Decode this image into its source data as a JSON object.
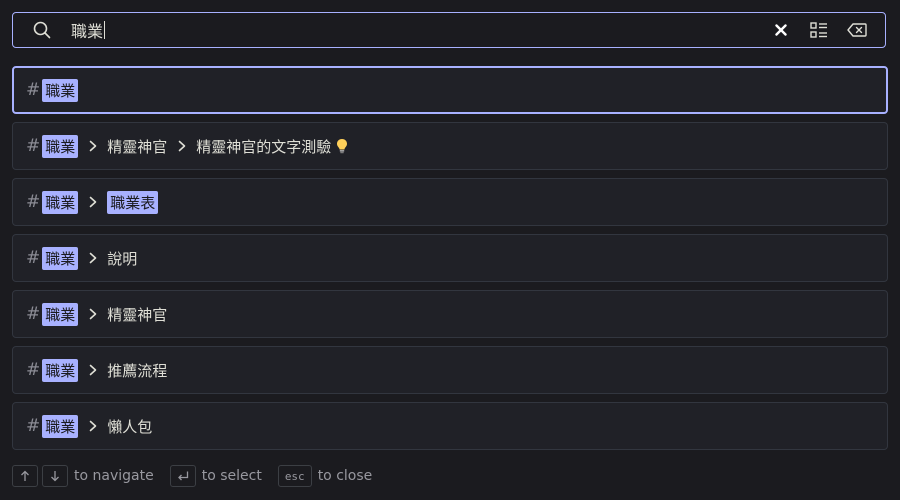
{
  "search": {
    "value": "職業",
    "actions": [
      {
        "name": "clear-icon"
      },
      {
        "name": "detailed-list-icon"
      },
      {
        "name": "backspace-icon"
      }
    ]
  },
  "results": [
    {
      "match": "職業",
      "path": []
    },
    {
      "match": "職業",
      "path": [
        {
          "text": "精靈神官",
          "hl": false
        },
        {
          "text": "精靈神官的文字測驗",
          "hl": false,
          "icon": "lightbulb-icon"
        }
      ]
    },
    {
      "match": "職業",
      "path": [
        {
          "text": "職業表",
          "hl": true
        }
      ]
    },
    {
      "match": "職業",
      "path": [
        {
          "text": "說明",
          "hl": false
        }
      ]
    },
    {
      "match": "職業",
      "path": [
        {
          "text": "精靈神官",
          "hl": false
        }
      ]
    },
    {
      "match": "職業",
      "path": [
        {
          "text": "推薦流程",
          "hl": false
        }
      ]
    },
    {
      "match": "職業",
      "path": [
        {
          "text": "懶人包",
          "hl": false
        }
      ]
    }
  ],
  "footer": {
    "navigate": "to navigate",
    "select": "to select",
    "esc_key": "esc",
    "close": "to close"
  },
  "colors": {
    "accent": "#a8b1ff",
    "background": "#1b1b1f",
    "item_background": "#202127"
  }
}
